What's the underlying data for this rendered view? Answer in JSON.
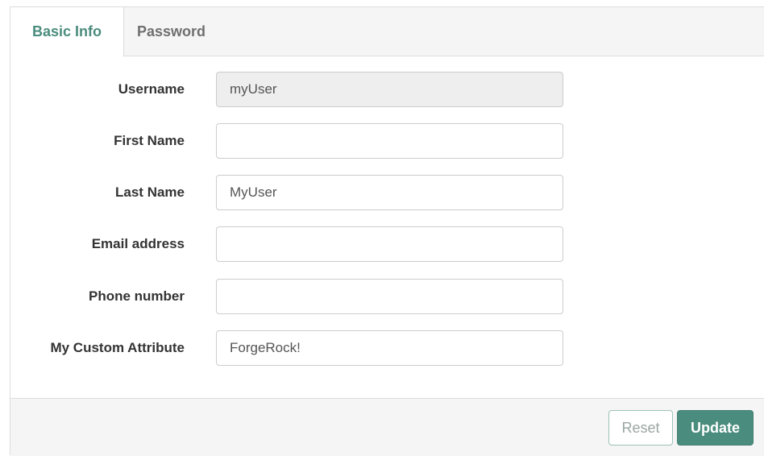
{
  "tabs": {
    "basic_info": "Basic Info",
    "password": "Password"
  },
  "form": {
    "username": {
      "label": "Username",
      "value": "myUser"
    },
    "first_name": {
      "label": "First Name",
      "value": ""
    },
    "last_name": {
      "label": "Last Name",
      "value": "MyUser"
    },
    "email": {
      "label": "Email address",
      "value": ""
    },
    "phone": {
      "label": "Phone number",
      "value": ""
    },
    "custom_attribute": {
      "label": "My Custom Attribute",
      "value": "ForgeRock!"
    }
  },
  "buttons": {
    "reset": "Reset",
    "update": "Update"
  },
  "colors": {
    "accent": "#4a8c7d",
    "tab_bar_bg": "#f5f5f5",
    "readonly_bg": "#eeeeee"
  }
}
